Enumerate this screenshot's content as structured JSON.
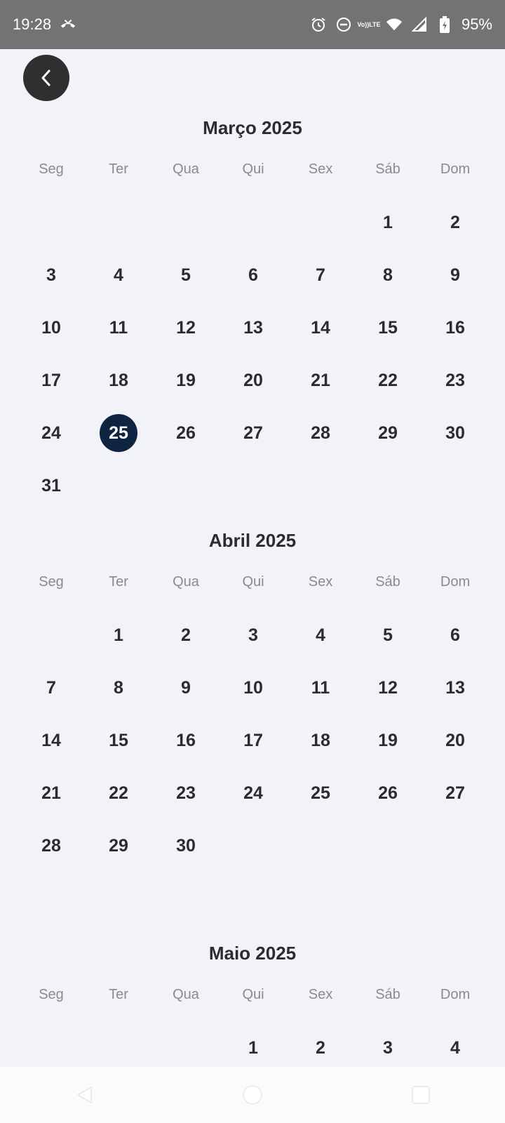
{
  "status_bar": {
    "time": "19:28",
    "battery": "95%",
    "network": "LTE",
    "network_top": "Vo))"
  },
  "colors": {
    "accent": "#0e2440",
    "background": "#f2f3f8",
    "status_bar": "#737373",
    "back_button": "#2f2f2f"
  },
  "icons": {
    "status_left": [
      "missed-call-icon"
    ],
    "status_right": [
      "alarm-icon",
      "do-not-disturb-icon",
      "volte-icon",
      "wifi-icon",
      "signal-icon",
      "battery-icon"
    ],
    "back": "chevron-left-icon",
    "nav": [
      "back-triangle-icon",
      "home-circle-icon",
      "recents-square-icon"
    ]
  },
  "weekdays": [
    "Seg",
    "Ter",
    "Qua",
    "Qui",
    "Sex",
    "Sáb",
    "Dom"
  ],
  "months": [
    {
      "title": "Março 2025",
      "weeks": [
        [
          "",
          "",
          "",
          "",
          "",
          "1",
          "2"
        ],
        [
          "3",
          "4",
          "5",
          "6",
          "7",
          "8",
          "9"
        ],
        [
          "10",
          "11",
          "12",
          "13",
          "14",
          "15",
          "16"
        ],
        [
          "17",
          "18",
          "19",
          "20",
          "21",
          "22",
          "23"
        ],
        [
          "24",
          "25",
          "26",
          "27",
          "28",
          "29",
          "30"
        ],
        [
          "31",
          "",
          "",
          "",
          "",
          "",
          ""
        ]
      ],
      "selected": "25"
    },
    {
      "title": "Abril 2025",
      "weeks": [
        [
          "",
          "1",
          "2",
          "3",
          "4",
          "5",
          "6"
        ],
        [
          "7",
          "8",
          "9",
          "10",
          "11",
          "12",
          "13"
        ],
        [
          "14",
          "15",
          "16",
          "17",
          "18",
          "19",
          "20"
        ],
        [
          "21",
          "22",
          "23",
          "24",
          "25",
          "26",
          "27"
        ],
        [
          "28",
          "29",
          "30",
          "",
          "",
          "",
          ""
        ]
      ],
      "selected": ""
    },
    {
      "title": "Maio 2025",
      "weeks": [
        [
          "",
          "",
          "",
          "1",
          "2",
          "3",
          "4"
        ]
      ],
      "selected": ""
    }
  ]
}
